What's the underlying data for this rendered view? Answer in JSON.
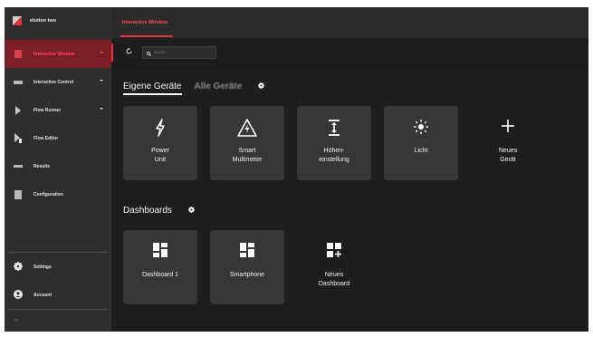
{
  "app": {
    "brand": "elution two"
  },
  "sidebar": {
    "items": [
      {
        "label": "Interactive Window",
        "icon": "window-icon",
        "active": true,
        "expandable": true
      },
      {
        "label": "Interactive Control",
        "icon": "sliders-icon",
        "active": false,
        "expandable": true
      },
      {
        "label": "Flow Runner",
        "icon": "play-flow-icon",
        "active": false,
        "expandable": true
      },
      {
        "label": "Flow Editor",
        "icon": "flow-edit-icon",
        "active": false,
        "expandable": false
      },
      {
        "label": "Results",
        "icon": "results-icon",
        "active": false,
        "expandable": false
      },
      {
        "label": "Configuration",
        "icon": "configuration-icon",
        "active": false,
        "expandable": false
      }
    ],
    "bottom": [
      {
        "label": "Settings",
        "icon": "gear-icon"
      },
      {
        "label": "Account",
        "icon": "account-icon"
      }
    ],
    "collapse_glyph": "‹‹"
  },
  "topbar": {
    "tab_label": "Interactive Window"
  },
  "toolbar": {
    "search_placeholder": "Suche ..."
  },
  "devices": {
    "tab_own": "Eigene Geräte",
    "tab_all": "Alle Geräte",
    "cards": [
      {
        "line1": "Power",
        "line2": "Unit",
        "icon": "bolt-icon"
      },
      {
        "line1": "Smart",
        "line2": "Multimeter",
        "icon": "warning-bolt-icon"
      },
      {
        "line1": "Höhen-",
        "line2": "einstellung",
        "icon": "height-adjust-icon"
      },
      {
        "line1": "Licht",
        "line2": "",
        "icon": "sun-icon"
      },
      {
        "line1": "Neues",
        "line2": "Gerät",
        "icon": "plus-icon"
      }
    ]
  },
  "dashboards": {
    "title": "Dashboards",
    "cards": [
      {
        "line1": "Dashboard 1",
        "line2": "",
        "icon": "dashboard-icon"
      },
      {
        "line1": "Smartphone",
        "line2": "",
        "icon": "dashboard-icon"
      },
      {
        "line1": "Neues",
        "line2": "Dashboard",
        "icon": "dashboard-add-icon"
      }
    ]
  },
  "colors": {
    "accent": "#e53040",
    "sidebar": "#2e2e2e",
    "background": "#1d1d1d",
    "card": "#363636"
  }
}
